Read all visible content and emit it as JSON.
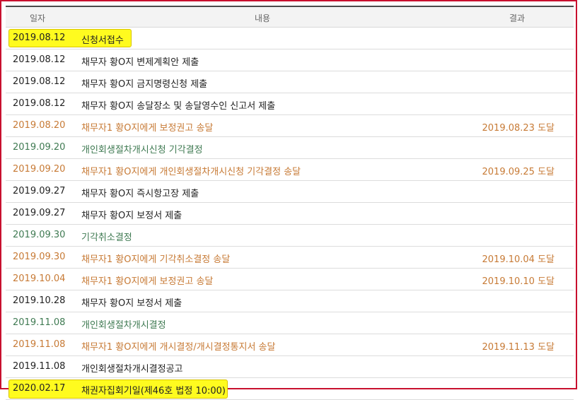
{
  "header": {
    "date": "일자",
    "content": "내용",
    "result": "결과"
  },
  "colors": {
    "black": "#222222",
    "orange": "#c77a35",
    "green": "#3f7a52",
    "highlight": "#fffb1f",
    "frame": "#c8102e"
  },
  "rows": [
    {
      "date": "2019.08.12",
      "content": "신청서접수",
      "result": ""
    },
    {
      "date": "2019.08.12",
      "content": "채무자 황O지 변제계획안 제출",
      "result": ""
    },
    {
      "date": "2019.08.12",
      "content": "채무자 황O지 금지명령신청 제출",
      "result": ""
    },
    {
      "date": "2019.08.12",
      "content": "채무자 황O지 송달장소 및 송달영수인 신고서 제출",
      "result": ""
    },
    {
      "date": "2019.08.20",
      "content": "채무자1 황O지에게 보정권고 송달",
      "result": "2019.08.23 도달"
    },
    {
      "date": "2019.09.20",
      "content": "개인회생절차개시신청 기각결정",
      "result": ""
    },
    {
      "date": "2019.09.20",
      "content": "채무자1 황O지에게 개인회생절차개시신청 기각결정 송달",
      "result": "2019.09.25 도달"
    },
    {
      "date": "2019.09.27",
      "content": "채무자 황O지 즉시항고장 제출",
      "result": ""
    },
    {
      "date": "2019.09.27",
      "content": "채무자 황O지 보정서 제출",
      "result": ""
    },
    {
      "date": "2019.09.30",
      "content": "기각취소결정",
      "result": ""
    },
    {
      "date": "2019.09.30",
      "content": "채무자1 황O지에게 기각취소결정 송달",
      "result": "2019.10.04 도달"
    },
    {
      "date": "2019.10.04",
      "content": "채무자1 황O지에게 보정권고 송달",
      "result": "2019.10.10 도달"
    },
    {
      "date": "2019.10.28",
      "content": "채무자 황O지 보정서 제출",
      "result": ""
    },
    {
      "date": "2019.11.08",
      "content": "개인회생절차개시결정",
      "result": ""
    },
    {
      "date": "2019.11.08",
      "content": "채무자1 황O지에게 개시결정/개시결정통지서 송달",
      "result": "2019.11.13 도달"
    },
    {
      "date": "2019.11.08",
      "content": "개인회생절차개시결정공고",
      "result": ""
    },
    {
      "date": "2020.02.17",
      "content": "채권자집회기일(제46호 법정 10:00)",
      "result": ""
    }
  ]
}
